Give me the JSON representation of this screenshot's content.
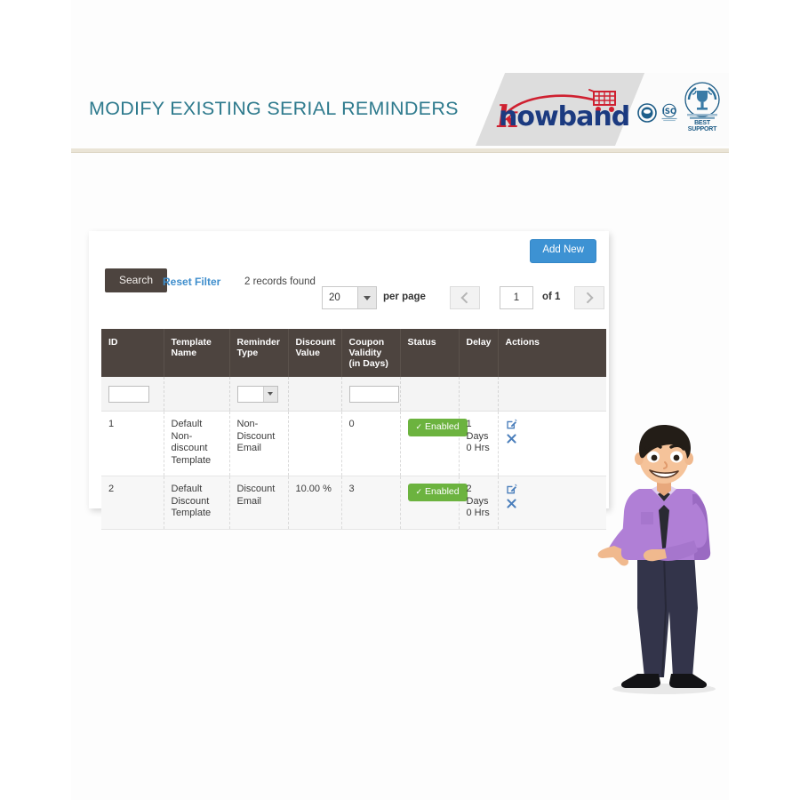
{
  "header": {
    "title": "MODIFY EXISTING SERIAL REMINDERS",
    "title_color": "#2e7a8d",
    "logo_k": "k",
    "logo_word": "nowband",
    "logo_icon": "shopping-cart-icon",
    "badges": [
      {
        "name": "certification-badge",
        "label": ""
      },
      {
        "name": "iso-badge",
        "label": "ISO"
      },
      {
        "name": "best-support-badge",
        "label": "BEST SUPPORT"
      }
    ]
  },
  "toolbar": {
    "add_new_label": "Add New",
    "add_new_color": "#3d92d3",
    "search_label": "Search",
    "search_color": "#4d443f",
    "reset_filter_label": "Reset Filter",
    "reset_filter_color": "#3f8ecc",
    "records_found": "2 records found"
  },
  "pagination": {
    "per_page_value": "20",
    "per_page_label": "per page",
    "prev_icon": "chevron-left-icon",
    "next_icon": "chevron-right-icon",
    "current_page": "1",
    "of_label": "of 1"
  },
  "table": {
    "columns": [
      {
        "key": "id",
        "label": "ID"
      },
      {
        "key": "template_name",
        "label": "Template Name"
      },
      {
        "key": "reminder_type",
        "label": "Reminder Type"
      },
      {
        "key": "discount_value",
        "label": "Discount Value"
      },
      {
        "key": "coupon_validity",
        "label": "Coupon Validity (in Days)"
      },
      {
        "key": "status",
        "label": "Status"
      },
      {
        "key": "delay",
        "label": "Delay"
      },
      {
        "key": "actions",
        "label": "Actions"
      }
    ],
    "filters": {
      "id_value": "",
      "reminder_type_value": "",
      "coupon_validity_value": ""
    },
    "rows": [
      {
        "id": "1",
        "template_name": "Default Non-discount Template",
        "reminder_type": "Non-Discount Email",
        "discount_value": "",
        "coupon_validity": "0",
        "status": "Enabled",
        "delay": "1 Days 0 Hrs",
        "delay_line1": "1",
        "delay_line2": "Days",
        "delay_line3": "0 Hrs",
        "edit_icon": "edit-icon",
        "delete_icon": "delete-icon"
      },
      {
        "id": "2",
        "template_name": "Default Discount Template",
        "reminder_type": "Discount Email",
        "discount_value": "10.00 %",
        "coupon_validity": "3",
        "status": "Enabled",
        "delay": "2 Days 0 Hrs",
        "delay_line1": "2",
        "delay_line2": "Days",
        "delay_line3": "0 Hrs",
        "edit_icon": "edit-icon",
        "delete_icon": "delete-icon"
      }
    ],
    "status_badge_color": "#6cb33f",
    "header_color": "#4d443f"
  },
  "mascot": {
    "name": "businessman-mascot",
    "shirt_color": "#b07fd6",
    "trouser_color": "#33344a"
  }
}
